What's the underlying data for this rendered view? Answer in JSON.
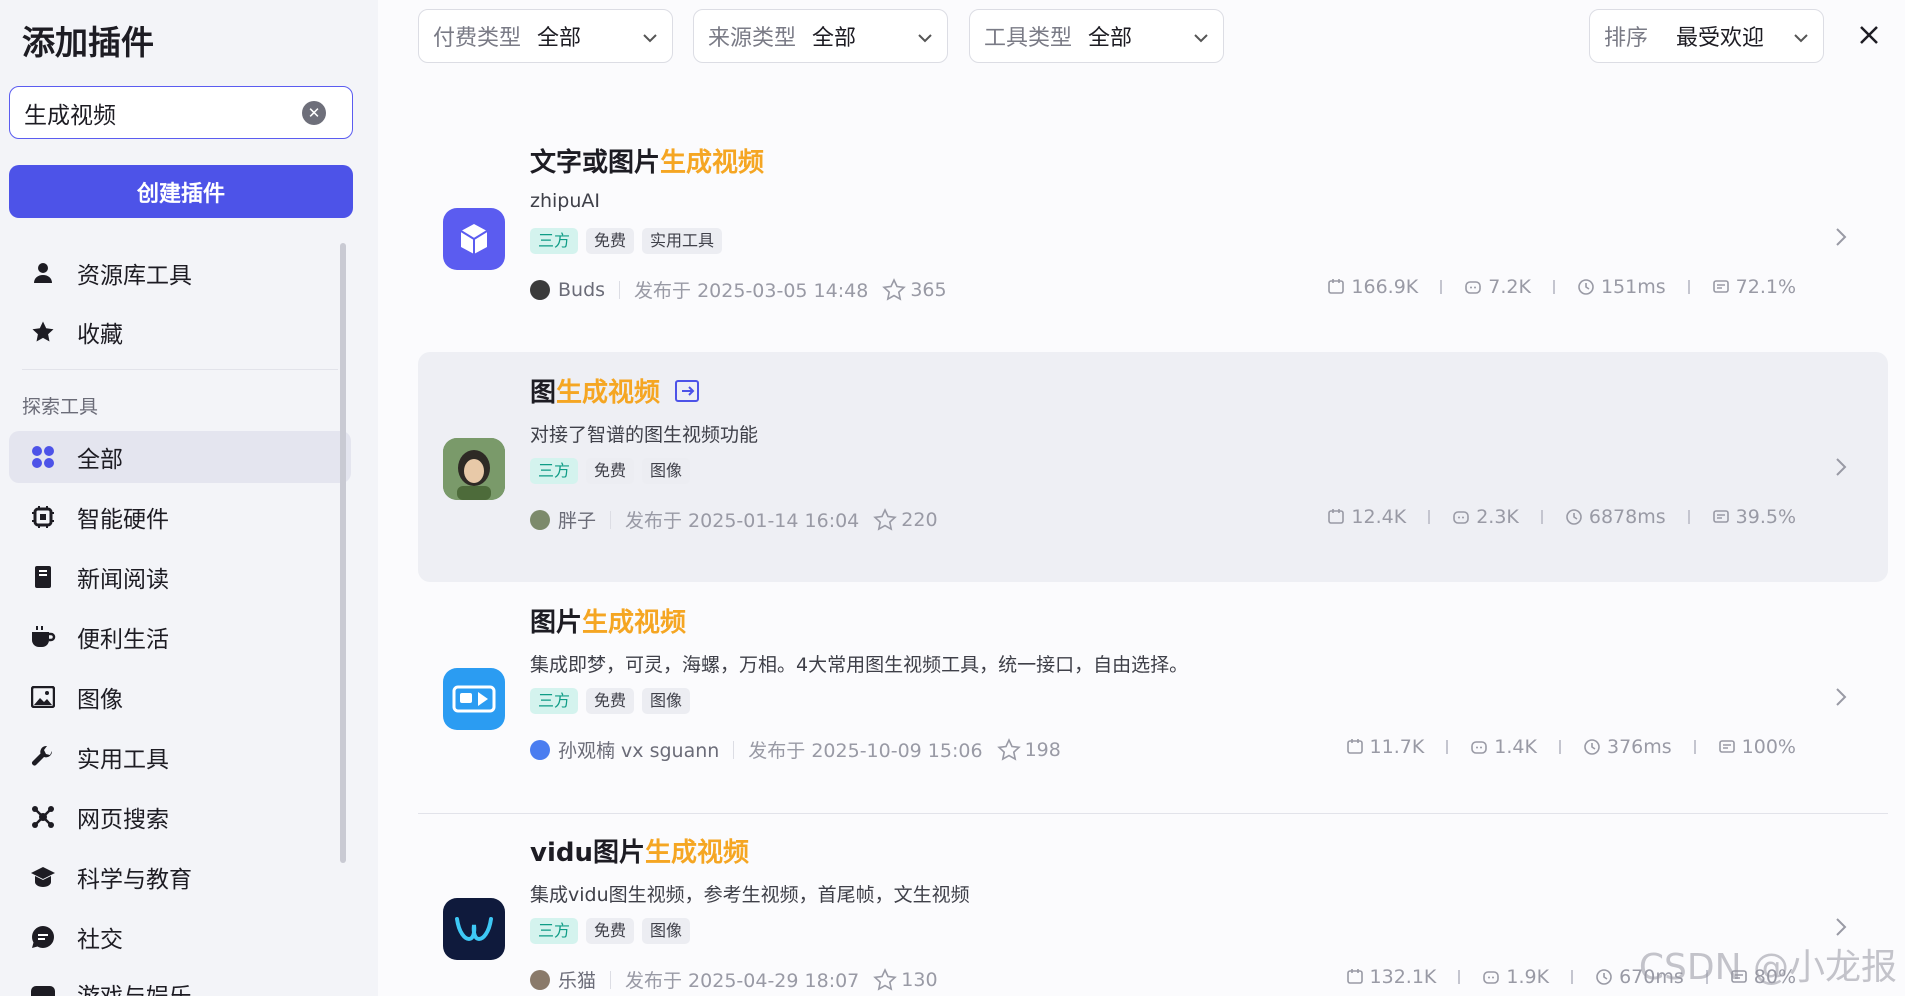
{
  "sidebar": {
    "title": "添加插件",
    "search": {
      "value": "生成视频"
    },
    "create_button": "创建插件",
    "top_items": [
      {
        "label": "资源库工具",
        "icon": "user-icon"
      },
      {
        "label": "收藏",
        "icon": "star-filled-icon"
      }
    ],
    "explore_header": "探索工具",
    "items": [
      {
        "label": "全部",
        "icon": "grid-icon",
        "active": true
      },
      {
        "label": "智能硬件",
        "icon": "chip-icon"
      },
      {
        "label": "新闻阅读",
        "icon": "book-icon"
      },
      {
        "label": "便利生活",
        "icon": "coffee-cup-icon"
      },
      {
        "label": "图像",
        "icon": "image-icon"
      },
      {
        "label": "实用工具",
        "icon": "wrench-icon"
      },
      {
        "label": "网页搜索",
        "icon": "network-icon"
      },
      {
        "label": "科学与教育",
        "icon": "graduation-cap-icon"
      },
      {
        "label": "社交",
        "icon": "chat-bubble-icon"
      },
      {
        "label": "游戏与娱乐",
        "icon": "gamepad-icon"
      }
    ]
  },
  "filters": [
    {
      "label": "付费类型",
      "value": "全部"
    },
    {
      "label": "来源类型",
      "value": "全部"
    },
    {
      "label": "工具类型",
      "value": "全部"
    }
  ],
  "sort": {
    "label": "排序",
    "value": "最受欢迎"
  },
  "plugins": [
    {
      "title_prefix": "文字或图片",
      "title_highlight": "生成视频",
      "subtitle": "zhipuAI",
      "tags": [
        "三方",
        "免费",
        "实用工具"
      ],
      "author": "Buds",
      "published": "发布于 2025-03-05 14:48",
      "favorites": "365",
      "stats": [
        "166.9K",
        "7.2K",
        "151ms",
        "72.1%"
      ],
      "icon_color": "#5b5cf0"
    },
    {
      "title_prefix": "图",
      "title_highlight": "生成视频",
      "subtitle": "对接了智谱的图生视频功能",
      "tags": [
        "三方",
        "免费",
        "图像"
      ],
      "author": "胖子",
      "published": "发布于 2025-01-14 16:04",
      "favorites": "220",
      "stats": [
        "12.4K",
        "2.3K",
        "6878ms",
        "39.5%"
      ],
      "icon_color": "#6b8f5e"
    },
    {
      "title_prefix": "图片",
      "title_highlight": "生成视频",
      "subtitle": "集成即梦，可灵，海螺，万相。4大常用图生视频工具，统一接口，自由选择。",
      "tags": [
        "三方",
        "免费",
        "图像"
      ],
      "author": "孙观楠 vx sguann",
      "published": "发布于 2025-10-09 15:06",
      "favorites": "198",
      "stats": [
        "11.7K",
        "1.4K",
        "376ms",
        "100%"
      ],
      "icon_color": "#2b9cf2"
    },
    {
      "title_prefix": "vidu图片",
      "title_highlight": "生成视频",
      "subtitle": "集成vidu图生视频，参考生视频，首尾帧，文生视频",
      "tags": [
        "三方",
        "免费",
        "图像"
      ],
      "author": "乐猫",
      "published": "发布于 2025-04-29 18:07",
      "favorites": "130",
      "stats": [
        "132.1K",
        "1.9K",
        "670ms",
        "80%"
      ],
      "icon_color": "#0f1a3c"
    }
  ],
  "watermark": "CSDN @小龙报"
}
